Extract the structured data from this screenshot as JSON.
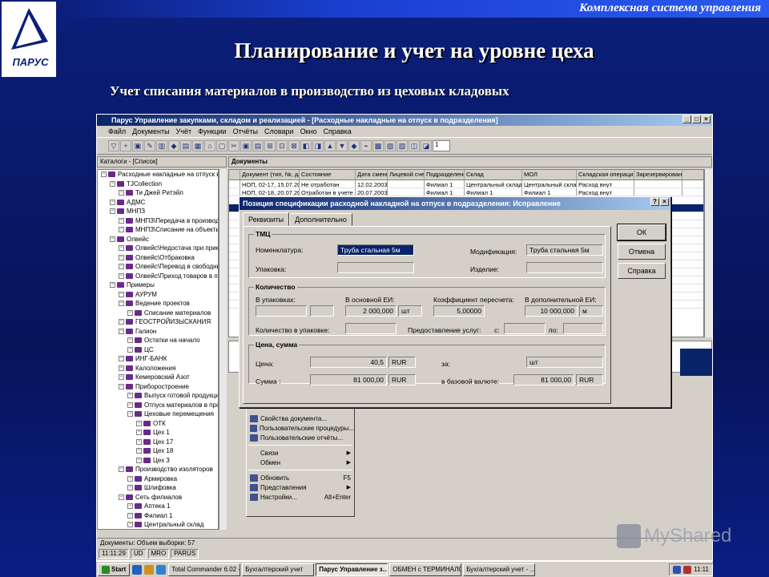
{
  "slide": {
    "brand_line": "Комплексная система управления",
    "logo_text": "ПАРУС",
    "title": "Планирование и учет на уровне цеха",
    "subtitle": "Учет списания материалов в производство из цеховых кладовых"
  },
  "app": {
    "title": "Парус Управление закупками, складом и реализацией - [Расходные накладные на отпуск в подразделения]",
    "menu": [
      "Файл",
      "Документы",
      "Учёт",
      "Функции",
      "Отчёты",
      "Словари",
      "Окно",
      "Справка"
    ],
    "toolbar_page": "1",
    "catalog_header": "Каталоги - [Список]",
    "documents_header": "Документы",
    "tree": [
      {
        "label": "Расходные накладные на отпуск в подра",
        "level": 0
      },
      {
        "label": "TJCollection",
        "level": 1
      },
      {
        "label": "Ти Джей Ритэйл",
        "level": 2
      },
      {
        "label": "АДМС",
        "level": 1
      },
      {
        "label": "МНПЗ",
        "level": 1
      },
      {
        "label": "МНПЗ\\Передача в производство",
        "level": 2
      },
      {
        "label": "МНПЗ\\Списание на объекты капст",
        "level": 2
      },
      {
        "label": "Олвейс",
        "level": 1
      },
      {
        "label": "Олвейс\\Недостача при приемке",
        "level": 2
      },
      {
        "label": "Олвейс\\Отбраковка",
        "level": 2
      },
      {
        "label": "Олвейс\\Перевод в свободный зап",
        "level": 2
      },
      {
        "label": "Олвейс\\Приход товаров в пути",
        "level": 2
      },
      {
        "label": "Примеры",
        "level": 1
      },
      {
        "label": "АУРУМ",
        "level": 2
      },
      {
        "label": "Ведение проектов",
        "level": 2
      },
      {
        "label": "Списание материалов",
        "level": 3
      },
      {
        "label": "ГЕОСТРОЙИЗЫСКАНИЯ",
        "level": 2
      },
      {
        "label": "Галион",
        "level": 2
      },
      {
        "label": "Остатки на начало",
        "level": 3
      },
      {
        "label": "ЦС",
        "level": 3
      },
      {
        "label": "ИНГ-БАНК",
        "level": 2
      },
      {
        "label": "Калоложения",
        "level": 2
      },
      {
        "label": "Кемеровский Азот",
        "level": 2
      },
      {
        "label": "Приборостроение",
        "level": 2
      },
      {
        "label": "Выпуск готовой продукции",
        "level": 3
      },
      {
        "label": "Отпуск материалов в произво",
        "level": 3
      },
      {
        "label": "Цеховые перемещения",
        "level": 3
      },
      {
        "label": "ОТК",
        "level": 4
      },
      {
        "label": "Цех 1",
        "level": 4
      },
      {
        "label": "Цех 17",
        "level": 4
      },
      {
        "label": "Цех 18",
        "level": 4
      },
      {
        "label": "Цех 3",
        "level": 4
      },
      {
        "label": "Производство изоляторов",
        "level": 2
      },
      {
        "label": "Армировка",
        "level": 3
      },
      {
        "label": "Шлифовка",
        "level": 3
      },
      {
        "label": "Сеть филиалов",
        "level": 2
      },
      {
        "label": "Аптека 1",
        "level": 3
      },
      {
        "label": "Филиал 1",
        "level": 3
      },
      {
        "label": "Центральный склад",
        "level": 3
      }
    ],
    "grid": {
      "columns": [
        "Документ (тип, №, дата)",
        "Состояние",
        "Дата смены",
        "Лицевой счет",
        "Подразделение",
        "Склад",
        "МОЛ",
        "Складская операция",
        "Зарезервирован"
      ],
      "rows": [
        [
          "НОП, 02-17, 15.07.2002",
          "Не отработан",
          "12.02.2003",
          "",
          "Филиал 1",
          "Центральный склад",
          "Центральный склад",
          "Расход внут",
          ""
        ],
        [
          "НОП, 02-18, 20.07.2002",
          "Отработан в учете",
          "20.07.2003",
          "",
          "Филиал 1",
          "Филиал 1",
          "Филиал 1",
          "Расход внут",
          ""
        ]
      ]
    },
    "status_text": "Документы: Объем выборки: 57",
    "status_cells": [
      "11:11:29",
      "UD",
      "MRO",
      "PARUS"
    ]
  },
  "context_menu": {
    "items": [
      {
        "label": "Свойства документа...",
        "shortcut": "",
        "submenu": false
      },
      {
        "label": "Пользовательские процедуры...",
        "shortcut": "",
        "submenu": false
      },
      {
        "label": "Пользовательские отчёты...",
        "shortcut": "",
        "submenu": false
      },
      {
        "label": "Связи",
        "shortcut": "",
        "submenu": true
      },
      {
        "label": "Обмен",
        "shortcut": "",
        "submenu": true
      },
      {
        "label": "Обновить",
        "shortcut": "F5",
        "submenu": false
      },
      {
        "label": "Представления",
        "shortcut": "",
        "submenu": true
      },
      {
        "label": "Настройки...",
        "shortcut": "Alt+Enter",
        "submenu": false
      }
    ]
  },
  "dialog": {
    "title": "Позиция спецификации расходной накладной на отпуск в подразделения: Исправление",
    "tabs": [
      "Реквизиты",
      "Дополнительно"
    ],
    "tmc": {
      "legend": "ТМЦ",
      "nomenclature_label": "Номенклатура:",
      "nomenclature_value": "Труба стальная 5м",
      "modification_label": "Модификация:",
      "modification_value": "Труба стальная 5м",
      "package_label": "Упаковка:",
      "product_label": "Изделие:"
    },
    "quantity": {
      "legend": "Количество",
      "in_packages_label": "В упаковках:",
      "main_unit_label": "В основной ЕИ:",
      "main_value": "2 000,000",
      "main_unit": "шт",
      "coef_label": "Коэффициент пересчета:",
      "coef_value": "5,00000",
      "extra_unit_label": "В дополнительной ЕИ:",
      "extra_value": "10 000,000",
      "extra_unit": "м",
      "qty_package_label": "Количество в упаковке:",
      "services_label": "Предоставление услуг:",
      "from_label": "с:",
      "to_label": "по:"
    },
    "price": {
      "legend": "Цена, сумма",
      "price_label": "Цена:",
      "price_value": "40,5",
      "price_cur": "RUR",
      "per_label": "за:",
      "per_value": "шт",
      "sum_label": "Сумма :",
      "sum_value": "81 000,00",
      "sum_cur": "RUR",
      "base_label": "в базовой валюте:",
      "base_value": "81 000,00",
      "base_cur": "RUR"
    },
    "buttons": {
      "ok": "ОК",
      "cancel": "Отмена",
      "help": "Справка"
    }
  },
  "taskbar": {
    "start": "Start",
    "tasks": [
      "Total Commander 6.02 - ...",
      "Бухгалтерский учет",
      "Парус Управление з...",
      "ОБМЕН с ТЕРМИНАЛОМ...",
      "Бухгалтерский учет - ..."
    ],
    "active_index": 2,
    "clock": "11:11"
  },
  "watermark": "MyShared",
  "colors": {
    "slide_bg": "#0b1f7a",
    "titlebar": "#0a246a",
    "window": "#d4d0c8"
  }
}
